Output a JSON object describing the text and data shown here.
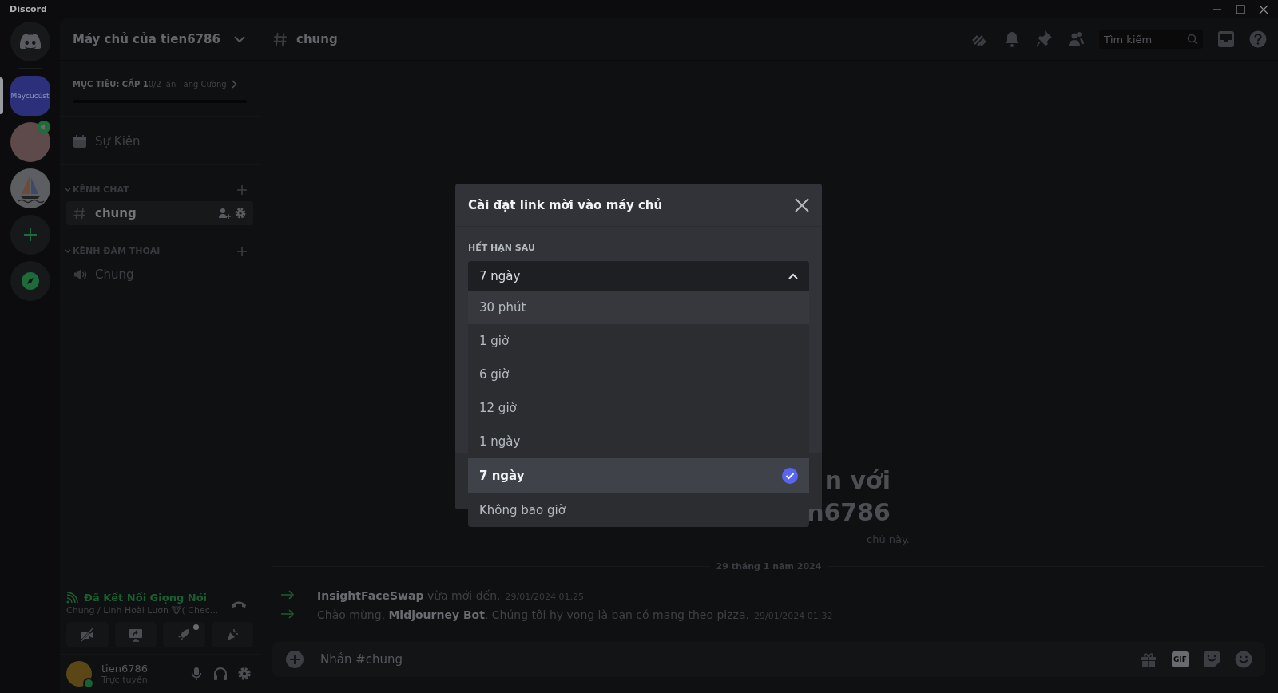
{
  "window": {
    "title": "Discord"
  },
  "servers": [
    {
      "kind": "home",
      "selected": false
    },
    {
      "kind": "text",
      "label": "Máycucúst",
      "selected": true
    },
    {
      "kind": "photo",
      "selected": false,
      "speaking": true
    },
    {
      "kind": "boat",
      "selected": false
    },
    {
      "kind": "add",
      "selected": false
    },
    {
      "kind": "explore",
      "selected": false
    }
  ],
  "sidebar": {
    "server_name": "Máy chủ của tien6786",
    "boost": {
      "goal": "MỤC TIÊU: CẤP 1",
      "progress": "0/2 lần Tăng Cường",
      "level": 0
    },
    "events": "Sự Kiện",
    "categories": [
      {
        "name": "KÊNH CHAT",
        "channels": [
          {
            "kind": "text",
            "name": "chung",
            "selected": true
          }
        ]
      },
      {
        "name": "KÊNH ĐÀM THOẠI",
        "channels": [
          {
            "kind": "voice",
            "name": "Chung",
            "selected": false
          }
        ]
      }
    ],
    "voice": {
      "status": "Đã Kết Nối Giọng Nói",
      "location": "Chung / Linh Hoài Lươn 🐮( Chec..."
    },
    "user": {
      "name": "tien6786",
      "status": "Trực tuyến"
    }
  },
  "header": {
    "channel": "chung",
    "search": {
      "placeholder": "Tìm kiếm"
    }
  },
  "chat": {
    "welcome_lines": [
      "n với",
      "n6786"
    ],
    "welcome_sub": "chủ này.",
    "date": "29 tháng 1 năm 2024",
    "messages": [
      {
        "text": "**InsightFaceSwap** vừa mới đến.",
        "time": "29/01/2024 01:25"
      },
      {
        "text": "Chào mừng, **Midjourney Bot**. Chúng tôi hy vọng là bạn có mang theo pizza.",
        "time": "29/01/2024 01:32"
      }
    ],
    "input": {
      "placeholder": "Nhắn #chung",
      "gif": "GIF"
    }
  },
  "modal": {
    "title": "Cài đặt link mời vào máy chủ",
    "label": "HẾT HẠN SAU",
    "select": {
      "value": "7 ngày",
      "expanded": true
    },
    "options": [
      {
        "label": "30 phút",
        "selected": false,
        "hovered": true
      },
      {
        "label": "1 giờ",
        "selected": false,
        "hovered": false
      },
      {
        "label": "6 giờ",
        "selected": false,
        "hovered": false
      },
      {
        "label": "12 giờ",
        "selected": false,
        "hovered": false
      },
      {
        "label": "1 ngày",
        "selected": false,
        "hovered": false
      },
      {
        "label": "7 ngày",
        "selected": true,
        "hovered": false
      },
      {
        "label": "Không bao giờ",
        "selected": false,
        "hovered": false
      }
    ]
  }
}
